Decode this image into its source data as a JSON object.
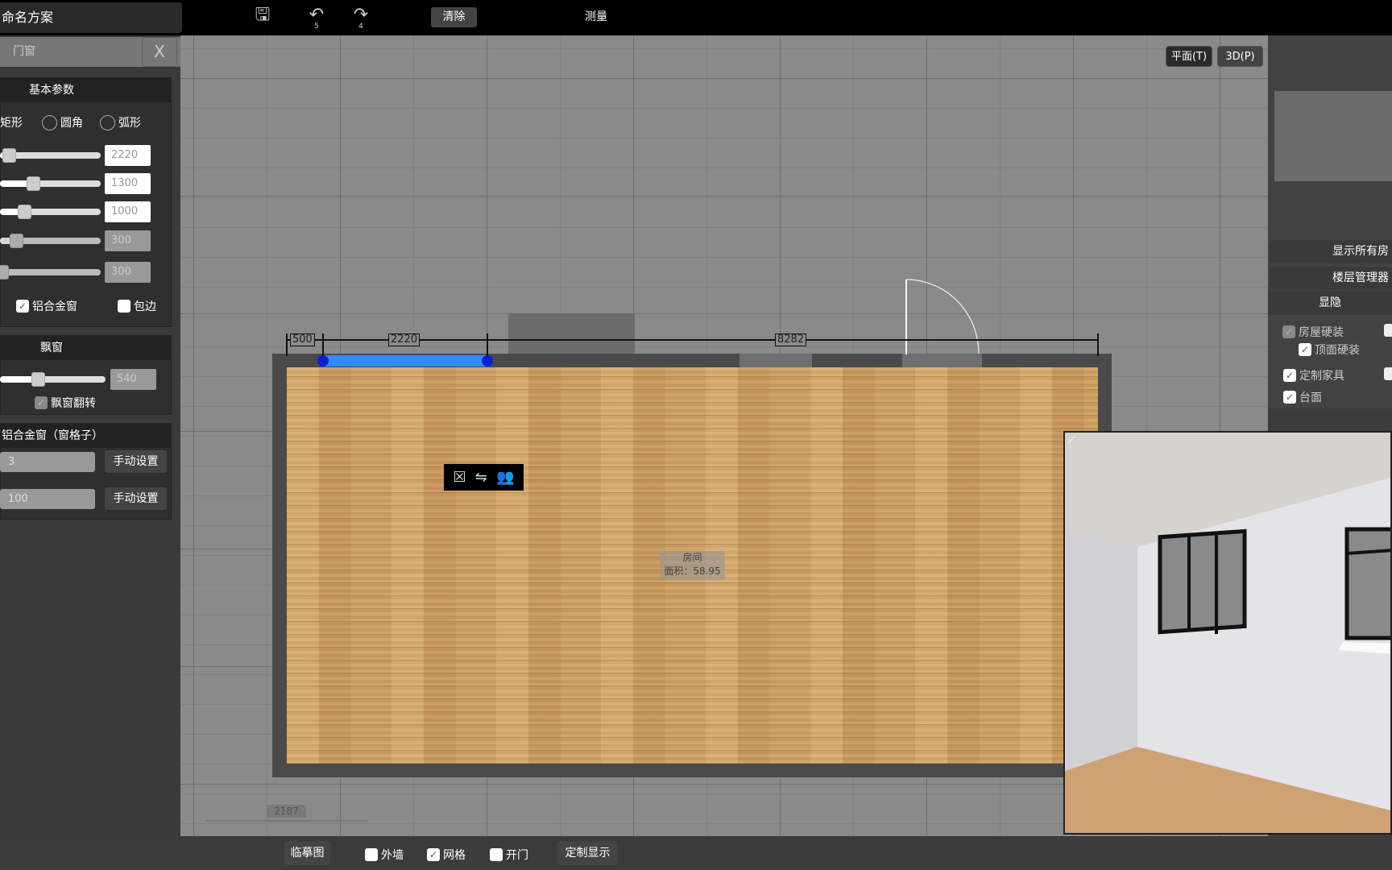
{
  "app": {
    "title": "命名方案"
  },
  "toolbar": {
    "save_icon": "save-icon",
    "undo_count": "5",
    "redo_count": "4",
    "clear_label": "清除",
    "measure_label": "测量"
  },
  "left_panel": {
    "header": "门窗",
    "close_label": "X",
    "basic": {
      "title": "基本参数",
      "shapes": [
        "矩形",
        "圆角",
        "弧形"
      ],
      "selected_shape": "矩形",
      "sliders": [
        {
          "value": "2220",
          "percent": 8,
          "disabled": false
        },
        {
          "value": "1300",
          "percent": 30,
          "disabled": false
        },
        {
          "value": "1000",
          "percent": 22,
          "disabled": false
        },
        {
          "value": "300",
          "percent": 15,
          "disabled": true
        },
        {
          "value": "300",
          "percent": 0,
          "disabled": true
        }
      ],
      "checkboxes": [
        {
          "label": "铝合金窗",
          "checked": true
        },
        {
          "label": "包边",
          "checked": false
        }
      ]
    },
    "bay": {
      "title": "飘窗",
      "slider": {
        "value": "540",
        "percent": 35
      },
      "flip_label": "飘窗翻转",
      "flip_checked": true
    },
    "grid": {
      "title": "铝合金窗（窗格子）",
      "rows": [
        {
          "value": "3",
          "button": "手动设置"
        },
        {
          "value": "100",
          "button": "手动设置"
        }
      ]
    }
  },
  "plan": {
    "dims": [
      "500",
      "2220",
      "8282"
    ],
    "room_name": "房间",
    "room_area": "面积：58.95",
    "size_label": "2187",
    "popup_icons": [
      "close-icon",
      "swap-icon",
      "users-icon"
    ]
  },
  "view_buttons": {
    "plan": "平面(T)",
    "three_d": "3D(P)"
  },
  "right_panel": {
    "show_all_rooms": "显示所有房",
    "floor_manager": "楼层管理器",
    "toggle_title": "显隐",
    "checks": [
      {
        "label": "房屋硬装",
        "checked": true,
        "disabled": true
      },
      {
        "label": "顶面硬装",
        "checked": true
      },
      {
        "label": "定制家具",
        "checked": true
      },
      {
        "label": "台面",
        "checked": true
      }
    ]
  },
  "bottom": {
    "trace_label": "临摹图",
    "outer_wall": "外墙",
    "outer_wall_checked": false,
    "grid": "网格",
    "grid_checked": true,
    "open_door": "开门",
    "open_door_checked": false,
    "custom_display": "定制显示"
  },
  "colors": {
    "selected_window": "#2f8cff",
    "handle": "#0a1fd6",
    "floor": "#c8995d"
  }
}
